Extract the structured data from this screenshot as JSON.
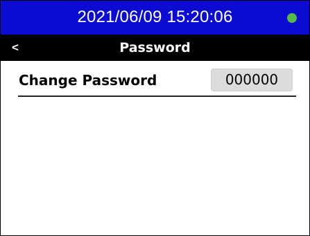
{
  "status_bar": {
    "datetime": "2021/06/09 15:20:06",
    "status_indicator_color": "#56b949",
    "background_color": "#0b0bd2"
  },
  "nav": {
    "back_label": "<",
    "title": "Password"
  },
  "settings": {
    "change_password": {
      "label": "Change Password",
      "value": "000000"
    }
  }
}
